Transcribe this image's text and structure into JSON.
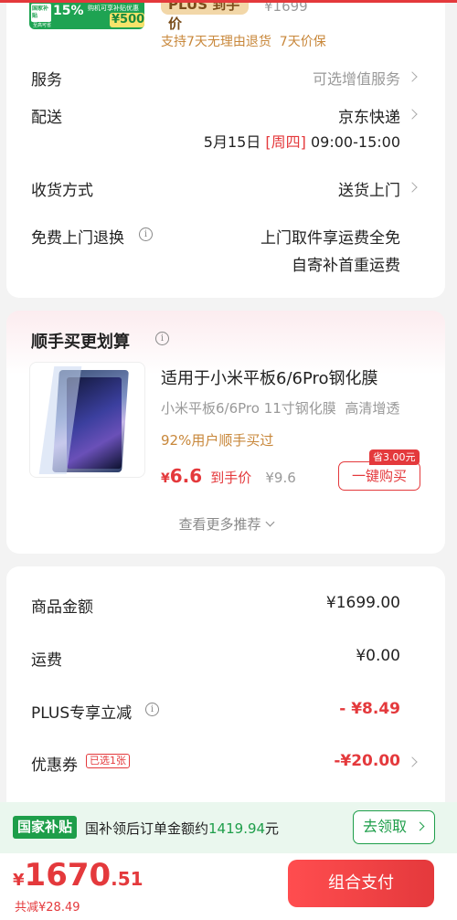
{
  "top": {
    "promo_badge": "国家补贴",
    "promo_percent": "15%",
    "promo_line1": "购机可享补贴优惠",
    "promo_line2": "至高可省",
    "promo_amount": "¥500",
    "plus_label": "PLUS 到手价",
    "plus_price": "¥1699",
    "guarantee": "支持7天无理由退货  7天价保"
  },
  "service": {
    "label": "服务",
    "value": "可选增值服务"
  },
  "delivery": {
    "label": "配送",
    "value": "京东快递",
    "date": "5月15日",
    "weekday": "[周四]",
    "time": "09:00-15:00"
  },
  "receive": {
    "label": "收货方式",
    "value": "送货上门"
  },
  "return": {
    "label": "免费上门退换",
    "line1": "上门取件享运费全免",
    "line2": "自寄补首重运费"
  },
  "addon": {
    "title": "顺手买更划算",
    "product_title": "适用于小米平板6/6Pro钢化膜",
    "product_subtitle": "小米平板6/6Pro 11寸钢化膜  高清增透",
    "bought_text": "92%用户顺手买过",
    "price_symbol": "¥",
    "price": "6.6",
    "price_label": "到手价",
    "orig_price": "¥9.6",
    "save_tag": "省3.00元",
    "buy_button": "一键购买",
    "more": "查看更多推荐"
  },
  "summary": {
    "goods_label": "商品金额",
    "goods_value": "¥1699.00",
    "freight_label": "运费",
    "freight_value": "¥0.00",
    "plus_label": "PLUS专享立减",
    "plus_value": "- ¥8.49",
    "coupon_label": "优惠券",
    "coupon_badge": "已选1张",
    "coupon_value": "-¥20.00"
  },
  "subsidy_bar": {
    "badge": "国家补贴",
    "text_prefix": "国补领后订单金额约",
    "amount": "1419.94",
    "text_suffix": "元",
    "claim_button": "去领取"
  },
  "bottom": {
    "currency": "¥",
    "price_int": "1670",
    "price_dec": ".51",
    "saved": "共减¥28.49",
    "pay_button": "组合支付"
  },
  "colors": {
    "accent": "#e4393c",
    "green": "#1e9e4a",
    "plus": "#f0c98a"
  }
}
